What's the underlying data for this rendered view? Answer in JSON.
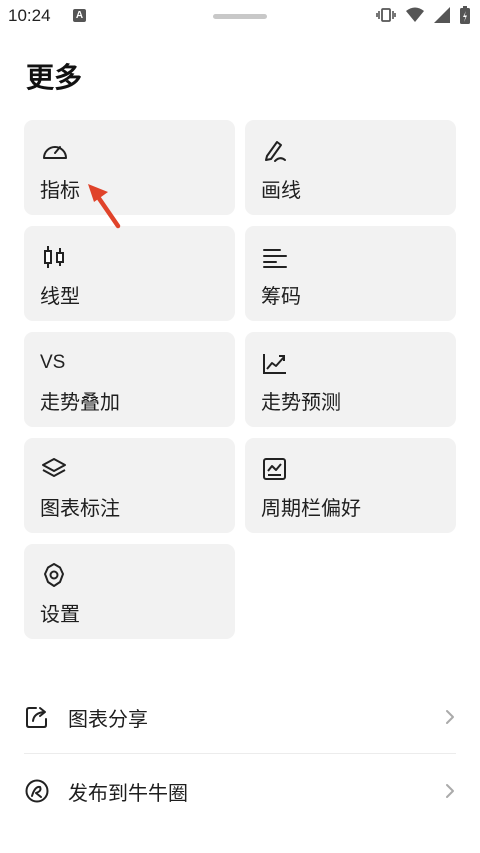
{
  "status": {
    "time": "10:24",
    "notif": "A"
  },
  "page": {
    "title": "更多"
  },
  "menu": [
    {
      "label": "指标",
      "icon": "gauge-icon"
    },
    {
      "label": "画线",
      "icon": "pen-draw-icon"
    },
    {
      "label": "线型",
      "icon": "candlestick-icon"
    },
    {
      "label": "筹码",
      "icon": "lines-align-icon"
    },
    {
      "label": "走势叠加",
      "icon": "vs-icon",
      "icon_text": "VS"
    },
    {
      "label": "走势预测",
      "icon": "trend-forecast-icon"
    },
    {
      "label": "图表标注",
      "icon": "layers-icon"
    },
    {
      "label": "周期栏偏好",
      "icon": "chart-frame-icon"
    },
    {
      "label": "设置",
      "icon": "gear-icon"
    }
  ],
  "list": [
    {
      "label": "图表分享",
      "icon": "share-icon"
    },
    {
      "label": "发布到牛牛圈",
      "icon": "niuniu-circle-icon"
    }
  ],
  "colors": {
    "card_bg": "#f2f2f2",
    "accent_arrow": "#e0432a"
  }
}
